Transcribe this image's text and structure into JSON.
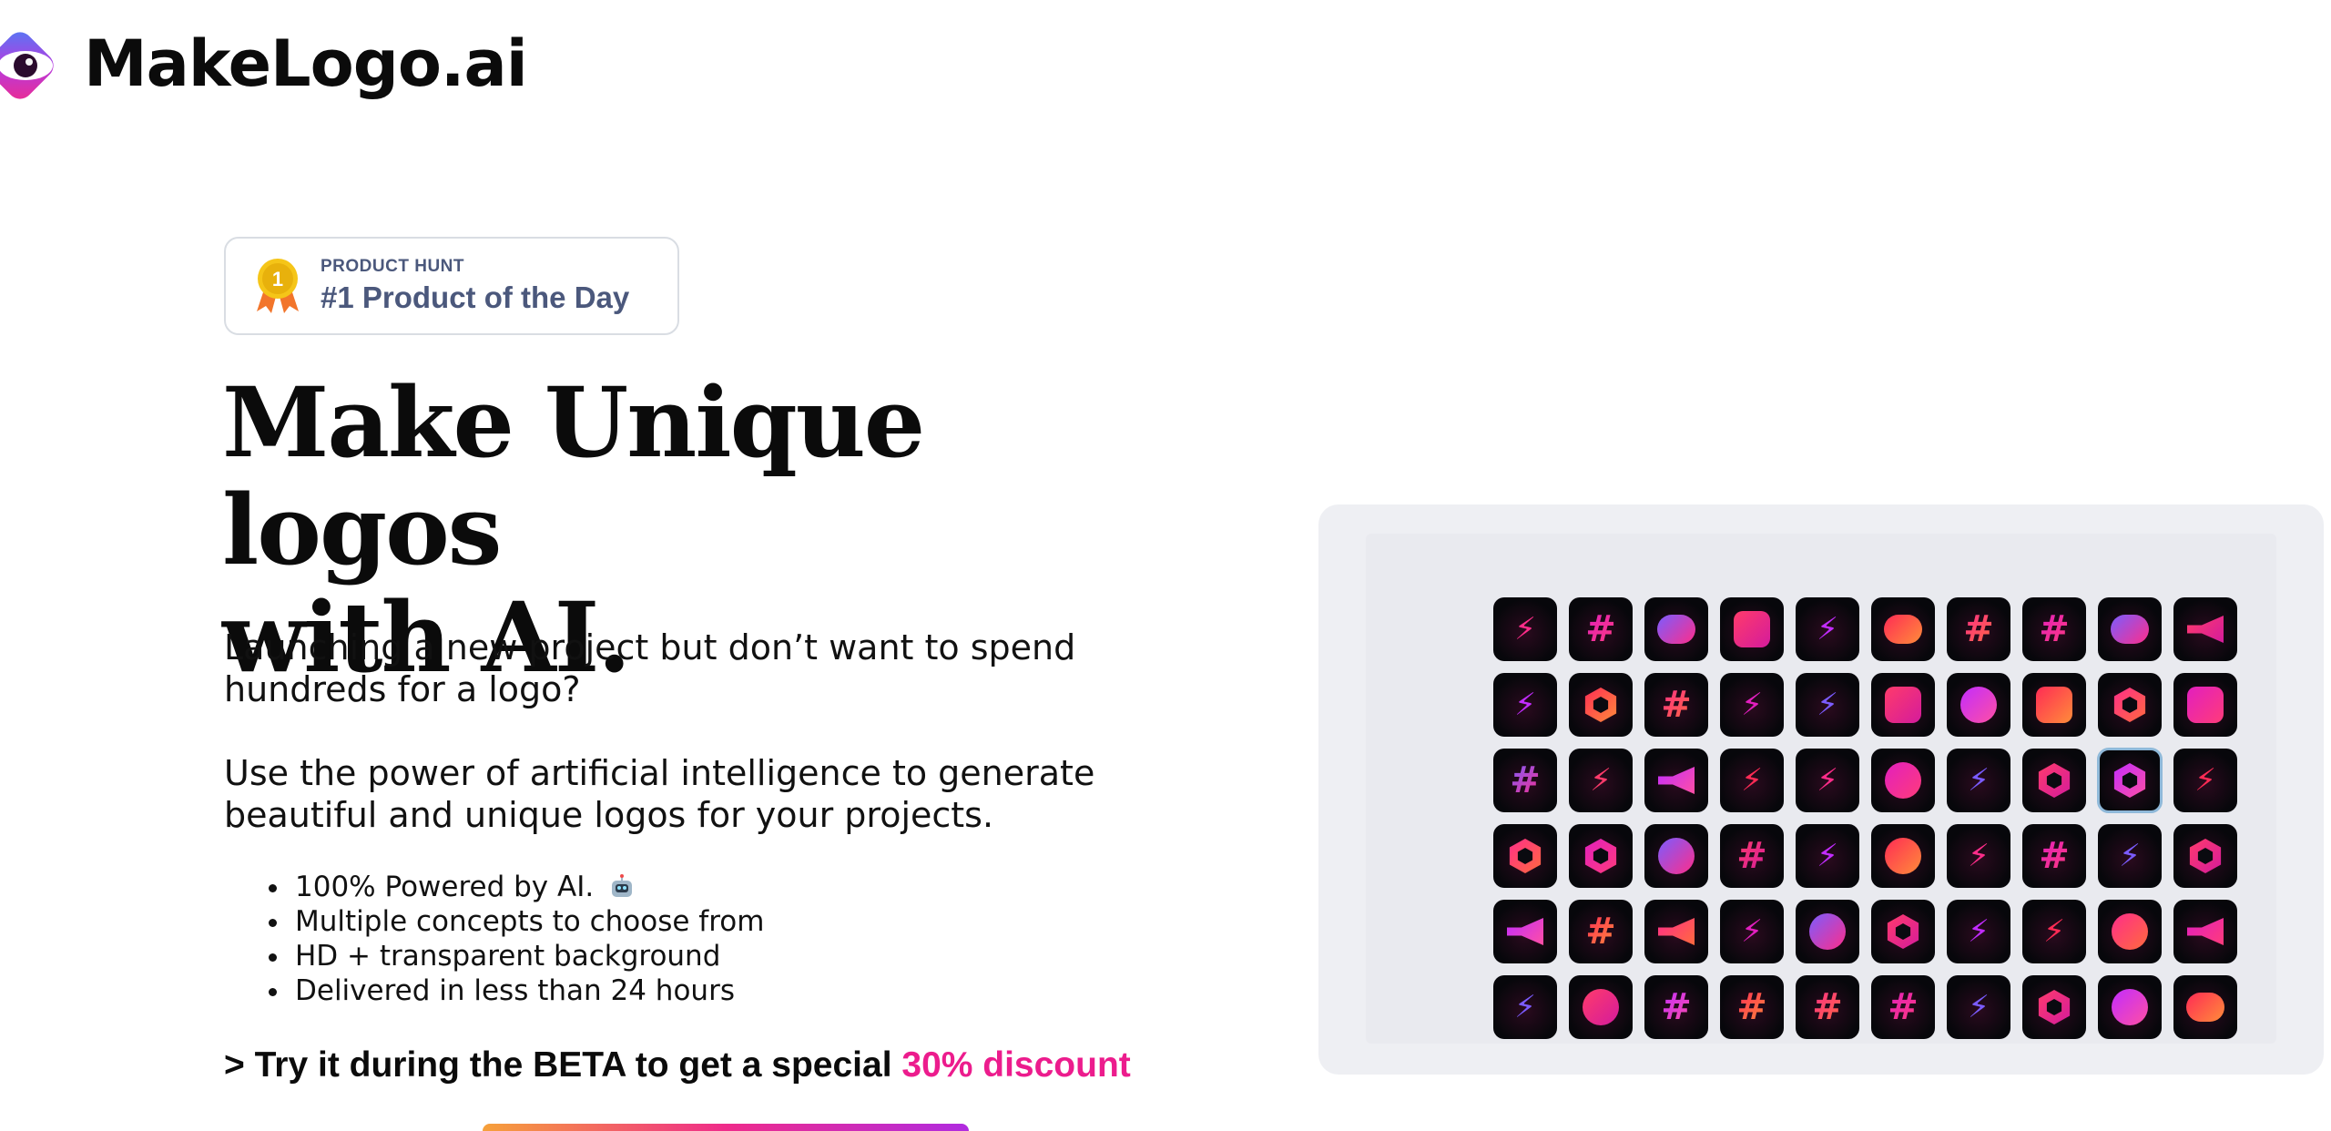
{
  "brand": {
    "name": "MakeLogo.ai"
  },
  "badge": {
    "small": "PRODUCT HUNT",
    "title": "#1 Product of the Day",
    "medal_number": "1"
  },
  "hero": {
    "headline_line1": "Make Unique logos",
    "headline_line2": "with AI.",
    "paragraph1": "Launching a new project but don’t want to spend hundreds for a logo?",
    "paragraph2": "Use the power of artificial intelligence to generate beautiful and unique logos for your projects.",
    "features": [
      "100% Powered by AI.",
      "Multiple concepts to choose from",
      "HD + transparent background",
      "Delivered in less than 24 hours"
    ],
    "feature_emoji": "robot-icon",
    "cta_prefix": "> Try it during the BETA to get a special ",
    "cta_highlight": "30% discount"
  },
  "colors": {
    "accent": "#ec1c8d",
    "badge_text": "#4b587c",
    "panel_bg": "#eeeff3",
    "tile_bg": "#07070b"
  },
  "logo_grid": {
    "columns": 10,
    "rows": 6,
    "tiles": [
      "bolt",
      "hash",
      "chat-bubble",
      "chat-square",
      "bolt",
      "chat-bubble",
      "hash",
      "hash",
      "chat-bubble",
      "megaphone",
      "bolt",
      "hexagon",
      "hash",
      "bolt",
      "bolt",
      "chat-square",
      "chat-circle",
      "heart-bubble",
      "hexagon",
      "chat-square",
      "hash",
      "bolt",
      "megaphone",
      "bolt",
      "bolt",
      "chat-circle",
      "bolt",
      "hexagon",
      "hexagon",
      "bolt",
      "hexagon",
      "hexagon",
      "chat-circle",
      "hash",
      "bolt",
      "chat-circle",
      "bolt",
      "hash",
      "bolt",
      "hexagon",
      "megaphone",
      "hash",
      "megaphone",
      "bolt",
      "chat-circle",
      "hexagon",
      "bolt",
      "bolt",
      "chat-circle",
      "megaphone",
      "bolt",
      "chat-circle",
      "hash",
      "hash",
      "hash",
      "hash",
      "bolt",
      "hexagon",
      "chat-circle",
      "chat-bubble"
    ]
  }
}
